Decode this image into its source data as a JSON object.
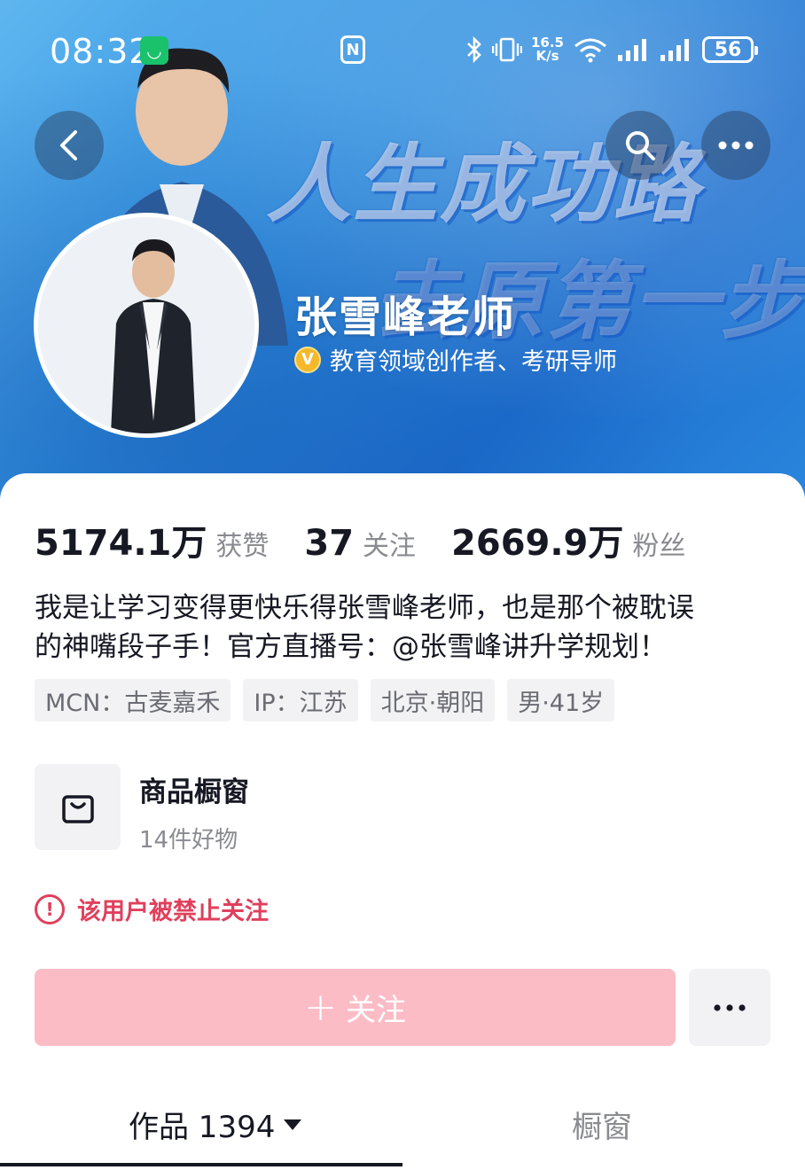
{
  "status_bar": {
    "time": "08:32",
    "mi_badge": "◡",
    "nfc": "N",
    "speed_top": "16.5",
    "speed_bottom": "K/s",
    "battery": "56"
  },
  "banner": {
    "slogan_line1": "人生成功路",
    "slogan_line2": "去原第一步"
  },
  "profile": {
    "name": "张雪峰老师",
    "verify_badge": "V",
    "verification": "教育领域创作者、考研导师"
  },
  "stats": [
    {
      "value": "5174.1万",
      "label": "获赞"
    },
    {
      "value": "37",
      "label": "关注"
    },
    {
      "value": "2669.9万",
      "label": "粉丝"
    }
  ],
  "bio": {
    "line1": "我是让学习变得更快乐得张雪峰老师，也是那个被耽误",
    "line2": "的神嘴段子手！官方直播号：@张雪峰讲升学规划！"
  },
  "tags": [
    "MCN：古麦嘉禾",
    "IP：江苏",
    "北京·朝阳",
    "男·41岁"
  ],
  "shop": {
    "title": "商品橱窗",
    "subtitle": "14件好物"
  },
  "warning": {
    "icon": "!",
    "text": "该用户被禁止关注"
  },
  "actions": {
    "follow_plus": "+",
    "follow_label": "关注"
  },
  "tabs": {
    "works": "作品 1394",
    "showcase": "橱窗"
  },
  "colors": {
    "banner_blue": "#2f8fe0",
    "warning_red": "#e0405c",
    "follow_pink": "#fcbcc6"
  }
}
